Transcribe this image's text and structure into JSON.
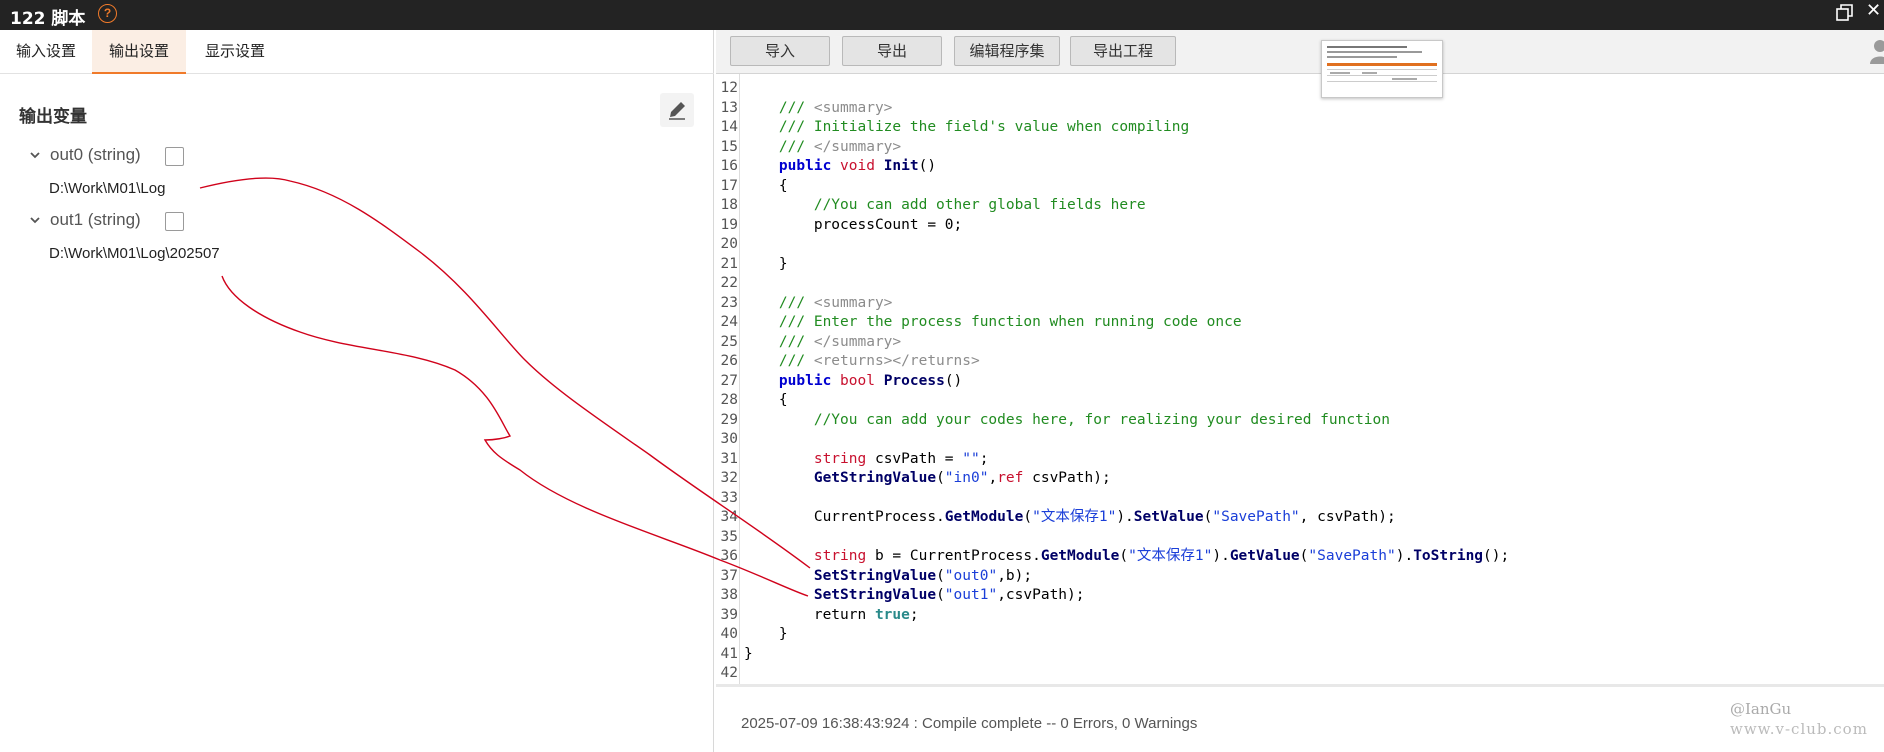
{
  "window": {
    "title": "122 脚本",
    "help_icon": "question-circle-icon",
    "help_glyph": "?"
  },
  "left_tabs": [
    {
      "label": "输入设置"
    },
    {
      "label": "输出设置",
      "active": true
    },
    {
      "label": "显示设置"
    }
  ],
  "output": {
    "section_title": "输出变量",
    "vars": [
      {
        "name": "out0 (string)",
        "value": "D:\\Work\\M01\\Log"
      },
      {
        "name": "out1 (string)",
        "value": "D:\\Work\\M01\\Log\\202507"
      }
    ]
  },
  "toolbar": {
    "import": "导入",
    "export": "导出",
    "edit_assemblies": "编辑程序集",
    "export_project": "导出工程"
  },
  "code": {
    "lines": [
      {
        "n": "12",
        "t": []
      },
      {
        "n": "13",
        "t": [
          [
            "    /// ",
            "cm"
          ],
          [
            "<summary>",
            "xt"
          ]
        ]
      },
      {
        "n": "14",
        "t": [
          [
            "    /// Initialize the field's value when compiling",
            "cm"
          ]
        ]
      },
      {
        "n": "15",
        "t": [
          [
            "    /// ",
            "cm"
          ],
          [
            "</summary>",
            "xt"
          ]
        ]
      },
      {
        "n": "16",
        "t": [
          [
            "    ",
            ""
          ],
          [
            "public",
            "kb"
          ],
          [
            " ",
            ""
          ],
          [
            "void",
            "kw"
          ],
          [
            " ",
            ""
          ],
          [
            "Init",
            "fn"
          ],
          [
            "()",
            ""
          ]
        ]
      },
      {
        "n": "17",
        "t": [
          [
            "    {",
            ""
          ]
        ]
      },
      {
        "n": "18",
        "t": [
          [
            "        //You can add other global fields here",
            "cm"
          ]
        ]
      },
      {
        "n": "19",
        "t": [
          [
            "        processCount = 0;",
            ""
          ]
        ]
      },
      {
        "n": "20",
        "t": []
      },
      {
        "n": "21",
        "t": [
          [
            "    }",
            ""
          ]
        ]
      },
      {
        "n": "22",
        "t": []
      },
      {
        "n": "23",
        "t": [
          [
            "    /// ",
            "cm"
          ],
          [
            "<summary>",
            "xt"
          ]
        ]
      },
      {
        "n": "24",
        "t": [
          [
            "    /// Enter the process function when running code once",
            "cm"
          ]
        ]
      },
      {
        "n": "25",
        "t": [
          [
            "    /// ",
            "cm"
          ],
          [
            "</summary>",
            "xt"
          ]
        ]
      },
      {
        "n": "26",
        "t": [
          [
            "    /// ",
            "cm"
          ],
          [
            "<returns></returns>",
            "xt"
          ]
        ]
      },
      {
        "n": "27",
        "t": [
          [
            "    ",
            ""
          ],
          [
            "public",
            "kb"
          ],
          [
            " ",
            ""
          ],
          [
            "bool",
            "kw"
          ],
          [
            " ",
            ""
          ],
          [
            "Process",
            "fn"
          ],
          [
            "()",
            ""
          ]
        ]
      },
      {
        "n": "28",
        "t": [
          [
            "    {",
            ""
          ]
        ]
      },
      {
        "n": "29",
        "t": [
          [
            "        //You can add your codes here, for realizing your desired function",
            "cm"
          ]
        ]
      },
      {
        "n": "30",
        "t": []
      },
      {
        "n": "31",
        "t": [
          [
            "        ",
            ""
          ],
          [
            "string",
            "kw"
          ],
          [
            " csvPath = ",
            ""
          ],
          [
            "\"\"",
            "st"
          ],
          [
            ";",
            ""
          ]
        ]
      },
      {
        "n": "32",
        "t": [
          [
            "        ",
            ""
          ],
          [
            "GetStringValue",
            "fn"
          ],
          [
            "(",
            ""
          ],
          [
            "\"in0\"",
            "st"
          ],
          [
            ",",
            ""
          ],
          [
            "ref",
            "kw"
          ],
          [
            " csvPath);",
            ""
          ]
        ]
      },
      {
        "n": "33",
        "t": []
      },
      {
        "n": "34",
        "t": [
          [
            "        CurrentProcess.",
            ""
          ],
          [
            "GetModule",
            "fn"
          ],
          [
            "(",
            ""
          ],
          [
            "\"文本保存1\"",
            "st"
          ],
          [
            ").",
            ""
          ],
          [
            "SetValue",
            "fn"
          ],
          [
            "(",
            ""
          ],
          [
            "\"SavePath\"",
            "st"
          ],
          [
            ", csvPath);",
            ""
          ]
        ]
      },
      {
        "n": "35",
        "t": []
      },
      {
        "n": "36",
        "t": [
          [
            "        ",
            ""
          ],
          [
            "string",
            "kw"
          ],
          [
            " b = CurrentProcess.",
            ""
          ],
          [
            "GetModule",
            "fn"
          ],
          [
            "(",
            ""
          ],
          [
            "\"文本保存1\"",
            "st"
          ],
          [
            ").",
            ""
          ],
          [
            "GetValue",
            "fn"
          ],
          [
            "(",
            ""
          ],
          [
            "\"SavePath\"",
            "st"
          ],
          [
            ").",
            ""
          ],
          [
            "ToString",
            "fn"
          ],
          [
            "();",
            ""
          ]
        ]
      },
      {
        "n": "37",
        "t": [
          [
            "        ",
            ""
          ],
          [
            "SetStringValue",
            "fn"
          ],
          [
            "(",
            ""
          ],
          [
            "\"out0\"",
            "st"
          ],
          [
            ",b);",
            ""
          ]
        ]
      },
      {
        "n": "38",
        "t": [
          [
            "        ",
            ""
          ],
          [
            "SetStringValue",
            "fn"
          ],
          [
            "(",
            ""
          ],
          [
            "\"out1\"",
            "st"
          ],
          [
            ",csvPath);",
            ""
          ]
        ]
      },
      {
        "n": "39",
        "t": [
          [
            "        return ",
            ""
          ],
          [
            "true",
            "ty"
          ],
          [
            ";",
            ""
          ]
        ]
      },
      {
        "n": "40",
        "t": [
          [
            "    }",
            ""
          ]
        ]
      },
      {
        "n": "41",
        "t": [
          [
            "}",
            ""
          ]
        ]
      },
      {
        "n": "42",
        "t": []
      }
    ]
  },
  "status": {
    "text": "2025-07-09 16:38:43:924 : Compile complete -- 0 Errors, 0 Warnings"
  },
  "watermark": {
    "line1": "@IanGu",
    "line2": "www.v-club.com"
  },
  "colors": {
    "accent": "#f07a2a",
    "annotation": "#d0021b",
    "titlebar": "#232323"
  }
}
